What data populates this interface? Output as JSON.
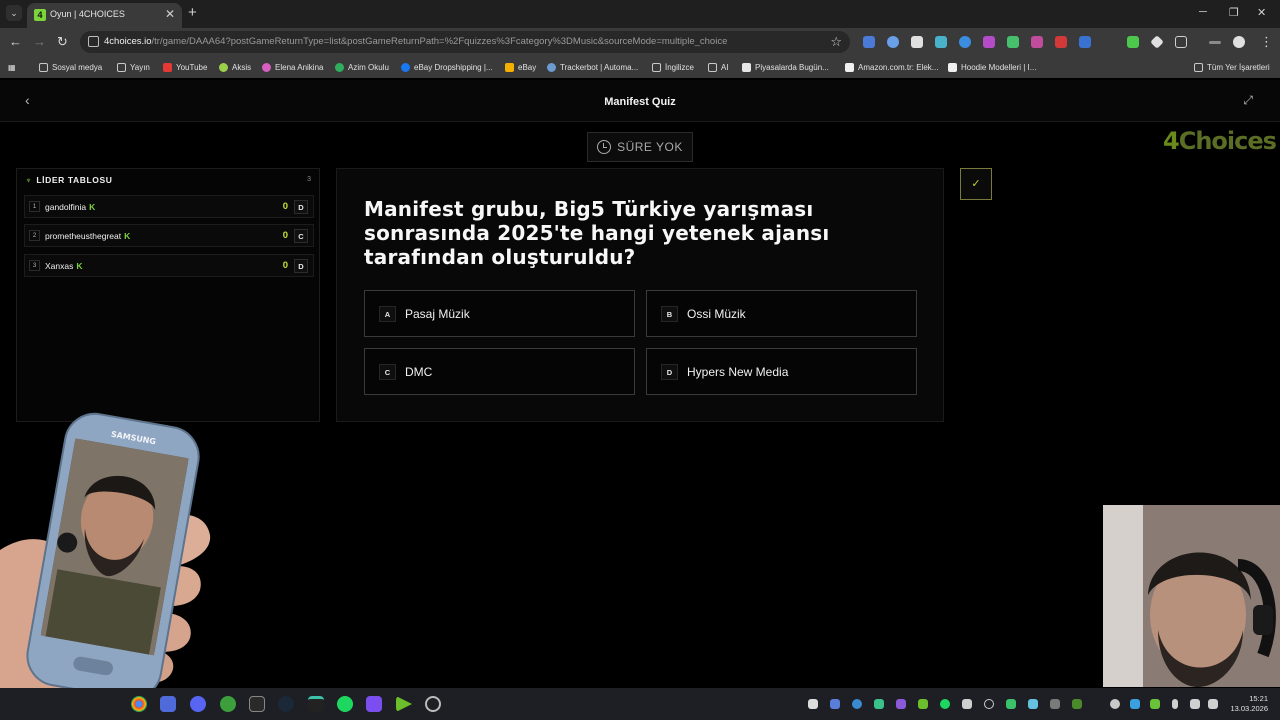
{
  "browser": {
    "tab_title": "Oyun | 4CHOICES",
    "tab_favicon": "4",
    "url_host": "4choices.io",
    "url_path": "/tr/game/DAAA64?postGameReturnType=list&postGameReturnPath=%2Fquizzes%3Fcategory%3DMusic&sourceMode=multiple_choice"
  },
  "bookmarks": [
    {
      "label": "Sosyal medya",
      "icon": "folder-icon",
      "color": "#c9c9c9"
    },
    {
      "label": "Yayın",
      "icon": "folder-icon",
      "color": "#c9c9c9"
    },
    {
      "label": "YouTube",
      "icon": "youtube-icon",
      "color": "#e53935"
    },
    {
      "label": "Aksis",
      "icon": "aksis-icon",
      "color": "#9bd14a"
    },
    {
      "label": "Elena Anikina",
      "icon": "elena-icon",
      "color": "#d65fbf"
    },
    {
      "label": "Azim Okulu",
      "icon": "azim-icon",
      "color": "#2fae5e"
    },
    {
      "label": "eBay Dropshipping |...",
      "icon": "facebook-icon",
      "color": "#1877f2"
    },
    {
      "label": "eBay",
      "icon": "ebay-icon",
      "color": "#f5af02"
    },
    {
      "label": "Trackerbot | Automa...",
      "icon": "trackerbot-icon",
      "color": "#6c9bd2"
    },
    {
      "label": "İngilizce",
      "icon": "document-icon",
      "color": "#c9c9c9"
    },
    {
      "label": "AI",
      "icon": "folder-icon",
      "color": "#c9c9c9"
    },
    {
      "label": "Piyasalarda Bugün...",
      "icon": "tv-icon",
      "color": "#e6e6e6"
    },
    {
      "label": "Amazon.com.tr: Elek...",
      "icon": "amazon-icon",
      "color": "#f0f0f0"
    },
    {
      "label": "Hoodie Modelleri | I...",
      "icon": "hoodie-icon",
      "color": "#f0f0f0"
    }
  ],
  "bookmarks_all": "Tüm Yer İşaretleri",
  "page": {
    "title": "Manifest Quiz",
    "timer": "SÜRE YOK",
    "logo_four": "4",
    "logo_text": "Choices"
  },
  "leaderboard": {
    "heading": "LİDER TABLOSU",
    "count": "3",
    "rows": [
      {
        "rank": "1",
        "name": "gandolfinia",
        "badge": "K",
        "score": "0",
        "answer": "D"
      },
      {
        "rank": "2",
        "name": "prometheusthegreat",
        "badge": "K",
        "score": "0",
        "answer": "C"
      },
      {
        "rank": "3",
        "name": "Xanxas",
        "badge": "K",
        "score": "0",
        "answer": "D"
      }
    ]
  },
  "question": {
    "text": "Manifest grubu, Big5 Türkiye yarışması sonrasında 2025'te hangi yetenek ajansı tarafından oluşturuldu?",
    "answers": [
      {
        "letter": "A",
        "text": "Pasaj Müzik"
      },
      {
        "letter": "B",
        "text": "Ossi Müzik"
      },
      {
        "letter": "C",
        "text": "DMC"
      },
      {
        "letter": "D",
        "text": "Hypers New Media"
      }
    ]
  },
  "phone_brand": "SAMSUNG",
  "taskbar": {
    "time": "15:21",
    "date": "13.03.2026"
  },
  "colors": {
    "accent_green": "#7ad23c",
    "score_yellow": "#c8e03a",
    "background": "#000000"
  }
}
